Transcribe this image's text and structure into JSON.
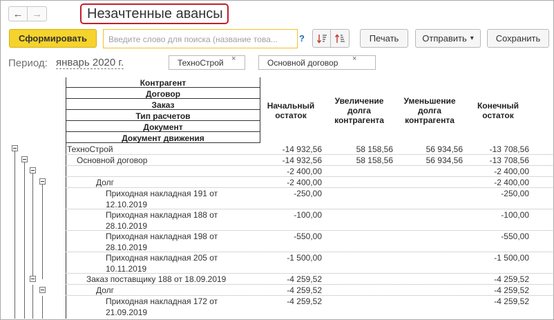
{
  "nav": {
    "back_glyph": "←",
    "forward_glyph": "→"
  },
  "window": {
    "title": "Незачтенные авансы"
  },
  "toolbar": {
    "generate_label": "Сформировать",
    "search_placeholder": "Введите слово для поиска (название това...",
    "help_label": "?",
    "print_label": "Печать",
    "send_label": "Отправить",
    "save_label": "Сохранить",
    "dropdown_glyph": "▾"
  },
  "period": {
    "label": "Период:",
    "value": "январь 2020 г."
  },
  "filters": [
    {
      "label": "ТехноСтрой",
      "close": "×"
    },
    {
      "label": "Основной договор",
      "close": "×"
    }
  ],
  "report": {
    "grouping_headers": [
      "Контрагент",
      "Договор",
      "Заказ",
      "Тип расчетов",
      "Документ",
      "Документ движения"
    ],
    "columns": [
      "Начальный\nостаток",
      "Увеличение\nдолга\nконтрагента",
      "Уменьшение\nдолга\nконтрагента",
      "Конечный\nостаток"
    ],
    "rows": [
      {
        "name": "ТехноСтрой",
        "start": "-14 932,56",
        "inc": "58 158,56",
        "dec": "56 934,56",
        "end": "-13 708,56"
      },
      {
        "name": "Основной договор",
        "start": "-14 932,56",
        "inc": "58 158,56",
        "dec": "56 934,56",
        "end": "-13 708,56"
      },
      {
        "name": "",
        "start": "-2 400,00",
        "inc": "",
        "dec": "",
        "end": "-2 400,00"
      },
      {
        "name": "Долг",
        "start": "-2 400,00",
        "inc": "",
        "dec": "",
        "end": "-2 400,00"
      },
      {
        "name": "Приходная накладная 191 от\n12.10.2019",
        "start": "-250,00",
        "inc": "",
        "dec": "",
        "end": "-250,00"
      },
      {
        "name": "Приходная накладная 188 от\n28.10.2019",
        "start": "-100,00",
        "inc": "",
        "dec": "",
        "end": "-100,00"
      },
      {
        "name": "Приходная накладная 198 от\n28.10.2019",
        "start": "-550,00",
        "inc": "",
        "dec": "",
        "end": "-550,00"
      },
      {
        "name": "Приходная накладная 205 от\n10.11.2019",
        "start": "-1 500,00",
        "inc": "",
        "dec": "",
        "end": "-1 500,00"
      },
      {
        "name": "Заказ поставщику 188 от 18.09.2019",
        "start": "-4 259,52",
        "inc": "",
        "dec": "",
        "end": "-4 259,52"
      },
      {
        "name": "Долг",
        "start": "-4 259,52",
        "inc": "",
        "dec": "",
        "end": "-4 259,52"
      },
      {
        "name": "Приходная накладная 172 от\n21.09.2019",
        "start": "-4 259,52",
        "inc": "",
        "dec": "",
        "end": "-4 259,52"
      }
    ]
  }
}
